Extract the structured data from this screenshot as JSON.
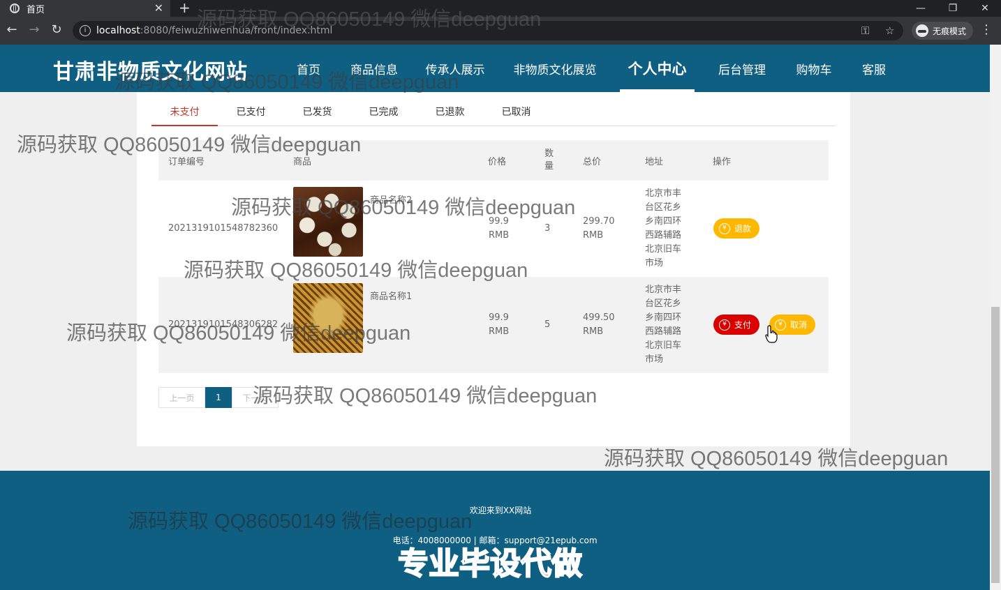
{
  "browser": {
    "tab_title": "首页",
    "url_host": "localhost",
    "url_path": ":8080/feiwuzhiwenhua/front/index.html",
    "incognito_label": "无痕模式"
  },
  "site": {
    "title": "甘肃非物质文化网站",
    "nav": [
      "首页",
      "商品信息",
      "传承人展示",
      "非物质文化展览",
      "个人中心",
      "后台管理",
      "购物车",
      "客服"
    ],
    "active_nav": "个人中心"
  },
  "order_tabs": [
    "未支付",
    "已支付",
    "已发货",
    "已完成",
    "已退款",
    "已取消"
  ],
  "active_tab": "未支付",
  "table": {
    "headers": {
      "order_no": "订单编号",
      "product": "商品",
      "price": "价格",
      "qty": "数\n量",
      "total": "总价",
      "address": "地址",
      "action": "操作"
    },
    "rows": [
      {
        "order_no": "2021319101548782360",
        "product_name": "商品名称2",
        "price": "99.9\nRMB",
        "qty": "3",
        "total": "299.70\nRMB",
        "address": "北京市丰\n台区花乡\n乡南四环\n西路辅路\n北京旧车\n市场",
        "buttons": [
          "退款"
        ]
      },
      {
        "order_no": "2021319101548306282",
        "product_name": "商品名称1",
        "price": "99.9\nRMB",
        "qty": "5",
        "total": "499.50\nRMB",
        "address": "北京市丰\n台区花乡\n乡南四环\n西路辅路\n北京旧车\n市场",
        "buttons": [
          "支付",
          "取消"
        ]
      }
    ]
  },
  "pager": {
    "prev": "上一页",
    "current": "1",
    "next": "下一页"
  },
  "footer": {
    "welcome": "欢迎来到XX网站",
    "contact": "电话：4008000000 | 邮箱：support@21epub.com"
  },
  "watermarks": {
    "text": "源码获取 QQ86050149 微信deepguan",
    "big": "专业毕设代做"
  },
  "colors": {
    "header": "#0f5f82",
    "pay_button": "#d90000",
    "refund_button": "#ffb800",
    "active_tab": "#c0392b"
  }
}
